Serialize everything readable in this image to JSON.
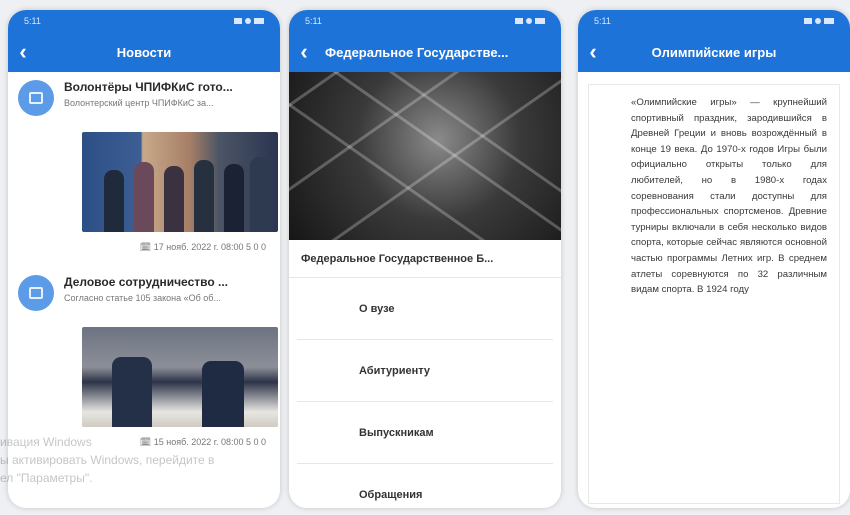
{
  "status": {
    "time1": "5:11",
    "time2": "5:11",
    "time3": "5:11"
  },
  "screen1": {
    "title": "Новости",
    "items": [
      {
        "title": "Волонтёры ЧПИФКиС гото...",
        "subtitle": "Волонтерский центр ЧПИФКиС за...",
        "meta": "17 нояб. 2022 г. 08:00 5 0 0"
      },
      {
        "title": "Деловое сотрудничество ...",
        "subtitle": "Согласно статье 105 закона «Об об...",
        "meta": "15 нояб. 2022 г. 08:00 5 0 0"
      }
    ]
  },
  "screen2": {
    "title": "Федеральное Государстве...",
    "org": "Федеральное Государственное Б...",
    "menu": [
      "О вузе",
      "Абитуриенту",
      "Выпускникам",
      "Обращения"
    ]
  },
  "screen3": {
    "title": "Олимпийские игры",
    "article": "«Олимпийские игры» — крупнейший спортивный праздник, зародившийся в Древней Греции и вновь возрождённый в конце 19 века. До 1970-х годов Игры были официально открыты только для любителей, но в 1980-х годах соревнования стали доступны для профессиональных спортсменов. Древние турниры включали в себя несколько видов спорта, которые сейчас являются основной частью программы Летних игр. В среднем атлеты соревнуются по 32 различным видам спорта. В 1924 году"
  },
  "watermark": {
    "line1": "ивация Windows",
    "line2": "ы активировать Windows, перейдите в",
    "line3": "ел \"Параметры\"."
  },
  "colors": {
    "primary": "#1e73d8",
    "avatar": "#5b9be8"
  }
}
